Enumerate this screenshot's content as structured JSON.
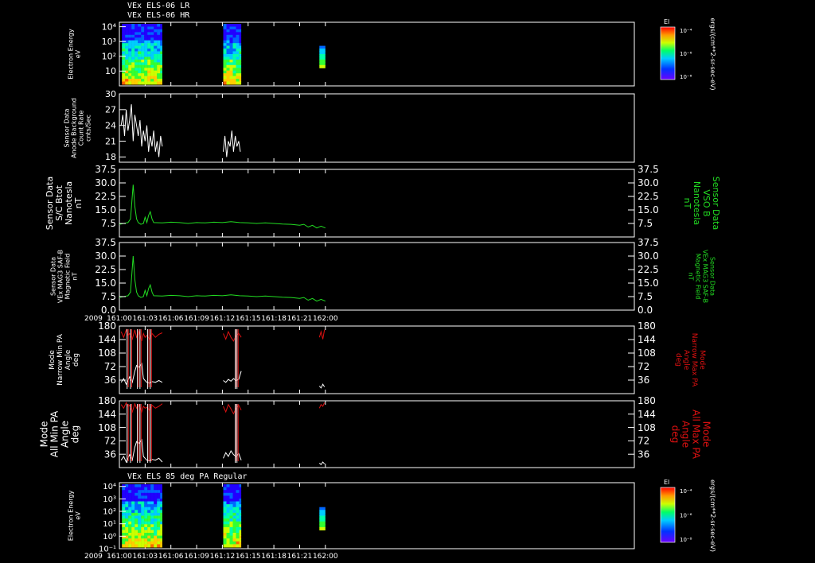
{
  "colors": {
    "background": "#000000",
    "axis": "#ffffff",
    "green_trace": "#22dd22",
    "red_trace": "#dd1111",
    "white_trace": "#ffffff"
  },
  "header": {
    "line1": "VEx ELS-06 LR",
    "line2": "VEx ELS-06 HR",
    "panel7_title": "VEx ELS 85 deg PA Regular"
  },
  "time_axis": {
    "start_min": 0,
    "end_min": 60,
    "ticks": [
      0,
      3,
      6,
      9,
      12,
      15,
      18,
      21,
      24
    ],
    "tick_labels": [
      "161:00",
      "161:03",
      "161:06",
      "161:09",
      "161:12",
      "161:15",
      "161:18",
      "161:21",
      "162:00"
    ],
    "year_label": "2009"
  },
  "chart_data": [
    {
      "type": "heatmap",
      "panel": "electron-spectrogram-1",
      "ylabel": [
        "Electron Energy",
        "eV"
      ],
      "y_scale": "log",
      "ylim": [
        1,
        20000
      ],
      "y_tick_labels": [
        "10",
        "10²",
        "10³",
        "10⁴"
      ],
      "y_tick_values": [
        10,
        100,
        1000,
        10000
      ],
      "colorbar": {
        "label": "El",
        "units": "ergs/(cm**2-sr-sec-eV)",
        "ticks": [
          "10⁻⁴",
          "10⁻⁶",
          "10⁻⁸"
        ]
      },
      "data_intervals_min": [
        [
          0.3,
          5.0
        ],
        [
          12.1,
          14.2
        ],
        [
          23.3,
          24.0
        ]
      ]
    },
    {
      "type": "line",
      "panel": "anode-background",
      "ylabel": [
        "Sensor Data",
        "Anode Background",
        "Count Rate",
        "cnts/Sec"
      ],
      "ylim": [
        17,
        30
      ],
      "y_ticks": [
        18,
        21,
        24,
        27,
        30
      ],
      "series": [
        {
          "color": "#ffffff",
          "segments": [
            {
              "x": [
                0.2,
                0.4,
                0.6,
                0.8,
                1.0,
                1.2,
                1.4,
                1.6,
                1.8,
                2.0,
                2.2,
                2.4,
                2.6,
                2.8,
                3.0,
                3.2,
                3.4,
                3.6,
                3.8,
                4.0,
                4.2,
                4.4,
                4.6,
                4.8,
                5.0
              ],
              "y": [
                24,
                26,
                22,
                27,
                23,
                25,
                28,
                21,
                26,
                24,
                22,
                25,
                20,
                23,
                21,
                24,
                19,
                22,
                20,
                23,
                19,
                21,
                18,
                22,
                20
              ]
            },
            {
              "x": [
                12.1,
                12.3,
                12.5,
                12.7,
                12.9,
                13.1,
                13.3,
                13.5,
                13.7,
                13.9,
                14.1
              ],
              "y": [
                19,
                22,
                18,
                21,
                20,
                23,
                19,
                22,
                20,
                21,
                19
              ]
            }
          ]
        }
      ]
    },
    {
      "type": "line",
      "panel": "b-total",
      "ylabel": [
        "Sensor Data",
        "S/C Btot",
        "Nanotesla",
        "nT"
      ],
      "right_label": [
        "Sensor Data",
        "VSO B",
        "Nanotesla",
        "nT"
      ],
      "ylim": [
        0,
        37.5
      ],
      "y_ticks": [
        7.5,
        15.0,
        22.5,
        30.0,
        37.5
      ],
      "series": [
        {
          "color": "#22dd22",
          "x": [
            0,
            0.5,
            1.0,
            1.3,
            1.6,
            1.8,
            2.0,
            2.2,
            2.5,
            2.8,
            3.0,
            3.2,
            3.4,
            3.6,
            3.8,
            4.0,
            5,
            6,
            7,
            8,
            9,
            10,
            11,
            12,
            13,
            14,
            15,
            16,
            17,
            18,
            19,
            20,
            21,
            21.5,
            22,
            22.5,
            23,
            23.5,
            24
          ],
          "y": [
            7,
            7.5,
            8,
            10,
            29,
            17,
            10,
            8,
            7,
            7.5,
            11,
            8,
            12,
            14,
            10,
            8,
            7.8,
            8.2,
            8,
            7.5,
            8,
            7.8,
            8.2,
            8,
            8.5,
            8,
            7.8,
            7.5,
            7.8,
            7.5,
            7.2,
            7,
            6.5,
            7,
            5.5,
            6.5,
            5,
            6,
            5
          ]
        }
      ]
    },
    {
      "type": "line",
      "panel": "b-mag3",
      "ylabel": [
        "Sensor Data",
        "VEx MAG3 SAF-B",
        "Magnetic Field",
        "nT"
      ],
      "right_label": [
        "Sensor Data",
        "VEx MAG3 SAF-B",
        "Magnetic Field",
        "nT"
      ],
      "ylim": [
        0,
        37.5
      ],
      "y_ticks": [
        0.0,
        7.5,
        15.0,
        22.5,
        30.0,
        37.5
      ],
      "series": [
        {
          "color": "#22dd22",
          "x": [
            0,
            0.5,
            1.0,
            1.3,
            1.6,
            1.8,
            2.0,
            2.2,
            2.5,
            2.8,
            3.0,
            3.2,
            3.4,
            3.6,
            3.8,
            4.0,
            5,
            6,
            7,
            8,
            9,
            10,
            11,
            12,
            13,
            14,
            15,
            16,
            17,
            18,
            19,
            20,
            21,
            21.5,
            22,
            22.5,
            23,
            23.5,
            24
          ],
          "y": [
            7,
            7.5,
            8,
            10,
            30,
            17,
            10,
            8,
            7,
            7.5,
            11,
            8,
            12,
            14,
            10,
            8,
            7.8,
            8.2,
            8,
            7.5,
            8,
            7.8,
            8.2,
            8,
            8.5,
            8,
            7.8,
            7.5,
            7.8,
            7.5,
            7.2,
            7,
            6.5,
            7,
            5.5,
            6.5,
            5,
            6,
            5
          ]
        }
      ]
    },
    {
      "type": "line",
      "panel": "pa-narrow",
      "ylabel": [
        "Mode",
        "Narrow Min PA",
        "Angle",
        "deg"
      ],
      "right_label": [
        "Mode",
        "Narrow Max PA",
        "Angle",
        "deg"
      ],
      "ylim": [
        0,
        180
      ],
      "y_ticks": [
        36,
        72,
        108,
        144,
        180
      ],
      "series": [
        {
          "color": "#ffffff",
          "segments": [
            {
              "x": [
                0.2,
                0.5,
                0.8,
                1.0,
                1.2,
                1.5,
                1.8,
                2.0,
                2.3,
                2.6,
                2.8,
                3.0,
                3.2,
                3.5,
                3.8,
                4.2,
                4.6,
                5.0
              ],
              "y": [
                30,
                40,
                25,
                35,
                45,
                30,
                60,
                75,
                70,
                80,
                40,
                35,
                30,
                28,
                32,
                30,
                35,
                30
              ]
            },
            {
              "x": [
                12.1,
                12.4,
                12.7,
                13.0,
                13.3,
                13.6,
                13.9,
                14.2
              ],
              "y": [
                35,
                30,
                38,
                33,
                40,
                35,
                38,
                60
              ]
            },
            {
              "x": [
                23.3,
                23.5,
                23.7,
                23.9
              ],
              "y": [
                20,
                15,
                25,
                18
              ]
            }
          ]
        },
        {
          "color": "#dd1111",
          "segments": [
            {
              "x": [
                0.2,
                0.5,
                0.8,
                1.0,
                1.2,
                1.5,
                1.8,
                2.0,
                2.3,
                2.6,
                2.8,
                3.0,
                3.2,
                3.5,
                3.8,
                4.2,
                4.6,
                5.0
              ],
              "y": [
                165,
                150,
                170,
                155,
                160,
                145,
                170,
                150,
                165,
                140,
                160,
                150,
                155,
                145,
                160,
                150,
                158,
                162
              ]
            },
            {
              "x": [
                12.1,
                12.4,
                12.7,
                13.0,
                13.3,
                13.6,
                13.9,
                14.2
              ],
              "y": [
                160,
                145,
                165,
                150,
                140,
                155,
                160,
                150
              ]
            },
            {
              "x": [
                23.3,
                23.5,
                23.7,
                23.9
              ],
              "y": [
                150,
                165,
                145,
                170
              ]
            }
          ]
        }
      ]
    },
    {
      "type": "line",
      "panel": "pa-all",
      "ylabel": [
        "Mode",
        "All Min PA",
        "Angle",
        "deg"
      ],
      "right_label": [
        "Mode",
        "All Max PA",
        "Angle",
        "deg"
      ],
      "ylim": [
        0,
        180
      ],
      "y_ticks": [
        36,
        72,
        108,
        144,
        180
      ],
      "series": [
        {
          "color": "#ffffff",
          "segments": [
            {
              "x": [
                0.2,
                0.5,
                0.8,
                1.0,
                1.2,
                1.5,
                1.8,
                2.0,
                2.3,
                2.6,
                2.8,
                3.0,
                3.2,
                3.5,
                3.8,
                4.2,
                4.6,
                5.0
              ],
              "y": [
                20,
                30,
                15,
                25,
                35,
                20,
                55,
                70,
                65,
                75,
                30,
                25,
                20,
                18,
                22,
                20,
                25,
                15
              ]
            },
            {
              "x": [
                12.1,
                12.4,
                12.7,
                13.0,
                13.3,
                13.6,
                13.9,
                14.2
              ],
              "y": [
                25,
                40,
                30,
                45,
                35,
                30,
                38,
                20
              ]
            },
            {
              "x": [
                23.3,
                23.5,
                23.7,
                23.9
              ],
              "y": [
                12,
                8,
                15,
                10
              ]
            }
          ]
        },
        {
          "color": "#dd1111",
          "segments": [
            {
              "x": [
                0.2,
                0.5,
                0.8,
                1.0,
                1.2,
                1.5,
                1.8,
                2.0,
                2.3,
                2.6,
                2.8,
                3.0,
                3.2,
                3.5,
                3.8,
                4.2,
                4.6,
                5.0
              ],
              "y": [
                170,
                160,
                175,
                165,
                168,
                150,
                172,
                160,
                170,
                150,
                165,
                160,
                162,
                155,
                168,
                160,
                165,
                172
              ]
            },
            {
              "x": [
                12.1,
                12.4,
                12.7,
                13.0,
                13.3,
                13.6,
                13.9,
                14.2
              ],
              "y": [
                165,
                150,
                170,
                158,
                145,
                160,
                168,
                155
              ]
            },
            {
              "x": [
                23.3,
                23.5,
                23.7,
                23.9
              ],
              "y": [
                160,
                170,
                165,
                175
              ]
            }
          ]
        }
      ]
    },
    {
      "type": "heatmap",
      "panel": "electron-spectrogram-2",
      "ylabel": [
        "Electron Energy",
        "eV"
      ],
      "y_scale": "log",
      "ylim": [
        0.1,
        20000
      ],
      "y_tick_labels": [
        "10⁻¹",
        "10⁰",
        "10¹",
        "10²",
        "10³",
        "10⁴"
      ],
      "y_tick_values": [
        0.1,
        1,
        10,
        100,
        1000,
        10000
      ],
      "colorbar": {
        "label": "El",
        "units": "ergs/(cm**2-sr-sec-eV)",
        "ticks": [
          "10⁻⁴",
          "10⁻⁶",
          "10⁻⁸"
        ]
      },
      "data_intervals_min": [
        [
          0.3,
          5.0
        ],
        [
          12.1,
          14.2
        ],
        [
          23.3,
          24.0
        ]
      ]
    }
  ]
}
